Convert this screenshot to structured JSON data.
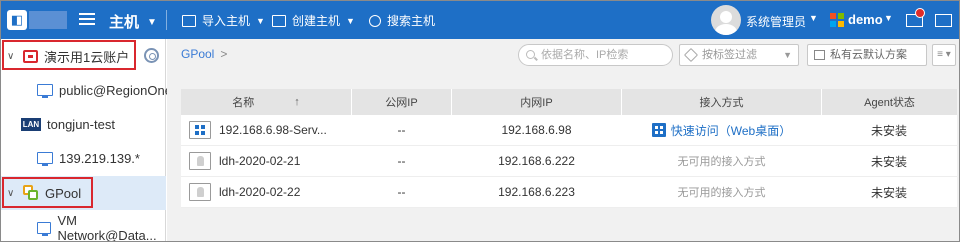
{
  "topbar": {
    "section_title": "主机",
    "actions": [
      {
        "label": "导入主机",
        "icon": "import-host-icon"
      },
      {
        "label": "创建主机",
        "icon": "create-host-icon"
      },
      {
        "label": "搜索主机",
        "icon": "search-host-icon"
      }
    ],
    "user_name": "系统管理员",
    "tenant_name": "demo",
    "brand_color": "#1e6fc6"
  },
  "sidebar": {
    "items": [
      {
        "label": "演示用1云账户",
        "icon": "cloud-account-icon",
        "expanded": true
      },
      {
        "label": "public@RegionOne",
        "icon": "network-icon"
      },
      {
        "label": "tongjun-test",
        "icon": "lan-icon",
        "badge": "LAN"
      },
      {
        "label": "139.219.139.*",
        "icon": "monitor-icon"
      },
      {
        "label": "GPool",
        "icon": "pool-icon",
        "selected": true,
        "expanded": true
      },
      {
        "label": "VM Network@Data...",
        "icon": "network-icon"
      }
    ]
  },
  "main": {
    "breadcrumb": "GPool",
    "search_placeholder": "依据名称、IP检索",
    "tag_filter_placeholder": "按标签过滤",
    "scheme_label": "私有云默认方案",
    "columns": [
      "名称",
      "公网IP",
      "内网IP",
      "接入方式",
      "Agent状态"
    ],
    "rows": [
      {
        "name": "192.168.6.98-Serv...",
        "os": "windows",
        "public_ip": "--",
        "private_ip": "192.168.6.98",
        "access": "快速访问（Web桌面）",
        "access_available": true,
        "agent": "未安装"
      },
      {
        "name": "ldh-2020-02-21",
        "os": "linux",
        "public_ip": "--",
        "private_ip": "192.168.6.222",
        "access": "无可用的接入方式",
        "access_available": false,
        "agent": "未安装"
      },
      {
        "name": "ldh-2020-02-22",
        "os": "linux",
        "public_ip": "--",
        "private_ip": "192.168.6.223",
        "access": "无可用的接入方式",
        "access_available": false,
        "agent": "未安装"
      }
    ]
  }
}
